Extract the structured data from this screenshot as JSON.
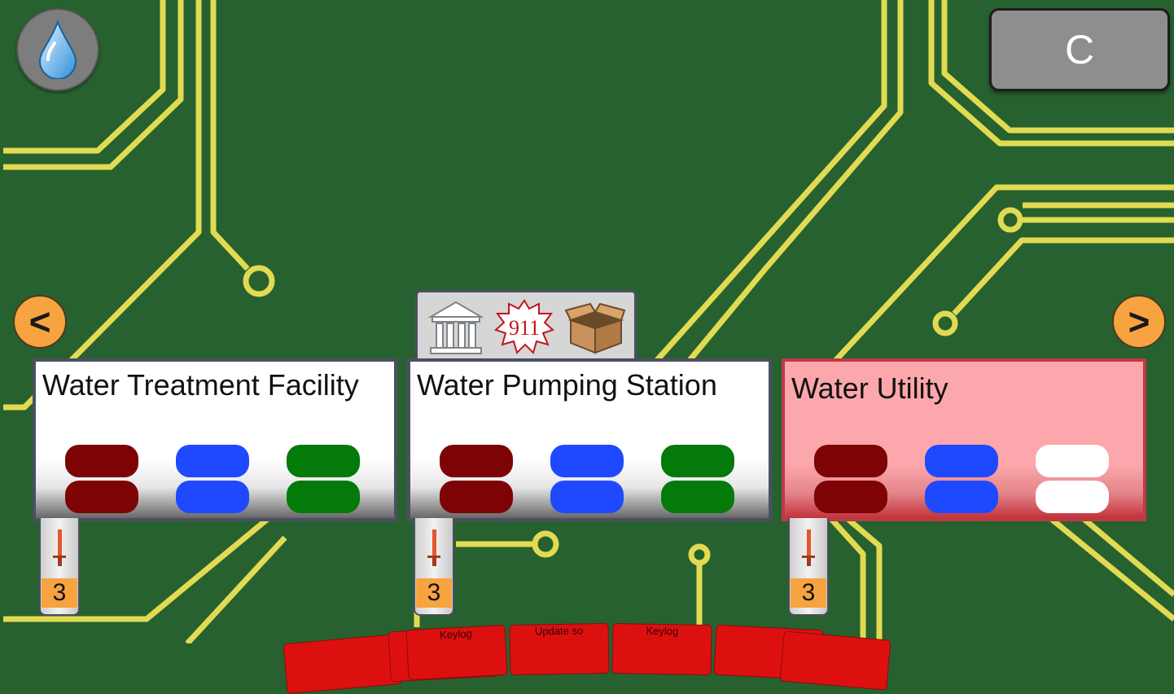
{
  "top_bar": {
    "water_icon": "water-drop-icon",
    "c_button_label": "C"
  },
  "navigation": {
    "prev_label": "<",
    "next_label": ">"
  },
  "icon_tray": {
    "icons": [
      "bank-icon",
      "emergency-911-icon",
      "box-icon"
    ],
    "emergency_text": "911"
  },
  "cards": [
    {
      "title": "Water Treatment Facility",
      "selected": false,
      "slots": [
        "#7d0304",
        "#1f49ff",
        "#037a0a"
      ],
      "count": "3"
    },
    {
      "title": "Water Pumping Station",
      "selected": false,
      "slots": [
        "#7d0304",
        "#1f49ff",
        "#037a0a"
      ],
      "count": "3"
    },
    {
      "title": "Water Utility",
      "selected": true,
      "slots": [
        "#7d0304",
        "#1f49ff",
        "#ffffff"
      ],
      "count": "3"
    }
  ],
  "hand_cards": [
    "Keylog",
    "Update so",
    "Keylog"
  ],
  "colors": {
    "board": "#27612f",
    "trace": "#e2db52",
    "accent_orange": "#f7a340",
    "hand_card": "#dd1010",
    "selected_card": "#fba7ab"
  }
}
